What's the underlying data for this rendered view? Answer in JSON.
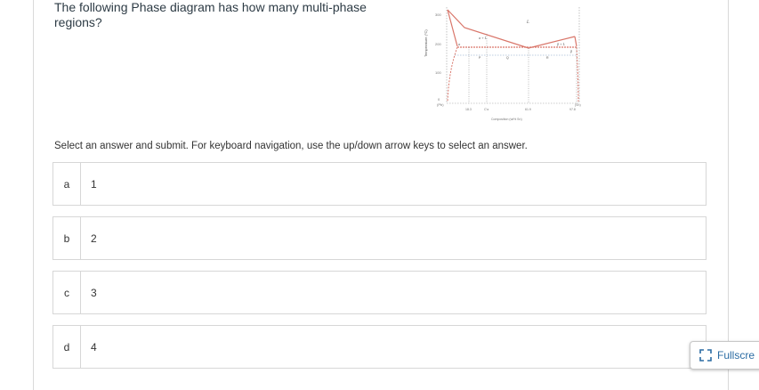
{
  "question": {
    "text": "The following Phase diagram has how many multi-phase regions?"
  },
  "diagram": {
    "y_axis_label": "Temperature (°C)",
    "y_ticks": [
      "300",
      "200",
      "100",
      "0"
    ],
    "x_axis_label": "Composition (wt% Sn)",
    "left_component": "(Pb)",
    "right_component": "(Sn)",
    "x_ticks": [
      "18.3",
      "C'α",
      "61.9",
      "97.8"
    ],
    "region_labels": {
      "liquid": "L",
      "alpha_liquid": "α + L",
      "beta_liquid": "β + L",
      "alpha": "α",
      "beta": "β",
      "point_p": "P",
      "point_q": "Q",
      "point_r": "R"
    },
    "line_color": "#d9766a"
  },
  "instructions": "Select an answer and submit. For keyboard navigation, use the up/down arrow keys to select an answer.",
  "choices": [
    {
      "letter": "a",
      "text": "1"
    },
    {
      "letter": "b",
      "text": "2"
    },
    {
      "letter": "c",
      "text": "3"
    },
    {
      "letter": "d",
      "text": "4"
    }
  ],
  "fullscreen": {
    "label": "Fullscre",
    "icon": "fullscreen-icon"
  }
}
